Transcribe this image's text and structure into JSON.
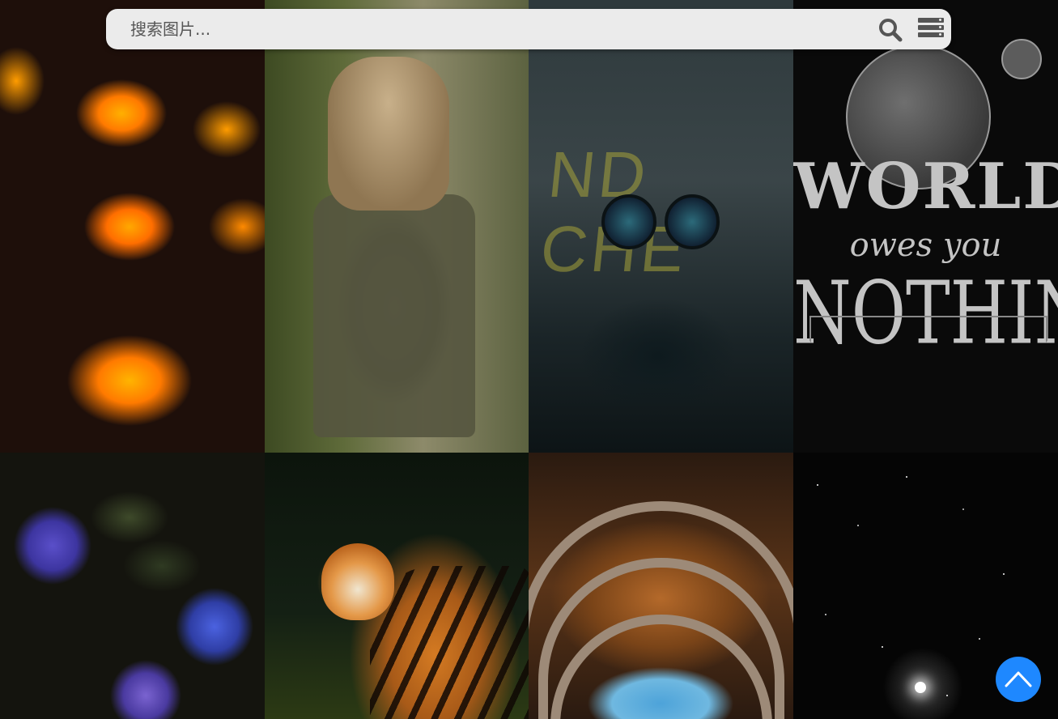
{
  "search": {
    "placeholder": "搜索图片..."
  },
  "icons": {
    "search": "search-icon",
    "menu": "server-list-icon",
    "back_to_top": "chevron-up-icon"
  },
  "colors": {
    "search_bg": "#ebebeb",
    "icon_gray": "#555555",
    "accent_blue": "#1e88ff"
  },
  "gallery": {
    "images": [
      {
        "subject": "hexagon-lights"
      },
      {
        "subject": "girl-backpack"
      },
      {
        "subject": "motorcycle-road"
      },
      {
        "subject": "world-owes-you-nothing",
        "text": [
          "WORLD",
          "owes you",
          "NOTHING"
        ]
      },
      {
        "subject": "hydrangeas"
      },
      {
        "subject": "tiger"
      },
      {
        "subject": "brick-arches"
      },
      {
        "subject": "starfield"
      }
    ],
    "road_text": "ND CHE"
  }
}
